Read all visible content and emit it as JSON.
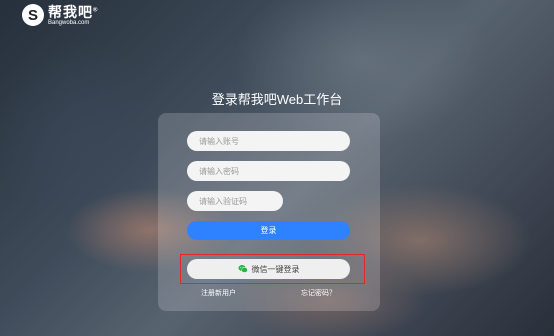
{
  "brand": {
    "logo_mark": "S",
    "name": "帮我吧",
    "reg": "®",
    "url": "Bangwoba.com"
  },
  "title": "登录帮我吧Web工作台",
  "form": {
    "account_placeholder": "请输入账号",
    "password_placeholder": "请输入密码",
    "captcha_placeholder": "请输入验证码",
    "login_label": "登录",
    "wechat_label": "微信一键登录",
    "register_label": "注册新用户",
    "forgot_label": "忘记密码？"
  },
  "colors": {
    "primary": "#2f82ff",
    "highlight": "#e02a2a",
    "wechat": "#28b445"
  },
  "icons": {
    "wechat": "wechat-icon"
  }
}
